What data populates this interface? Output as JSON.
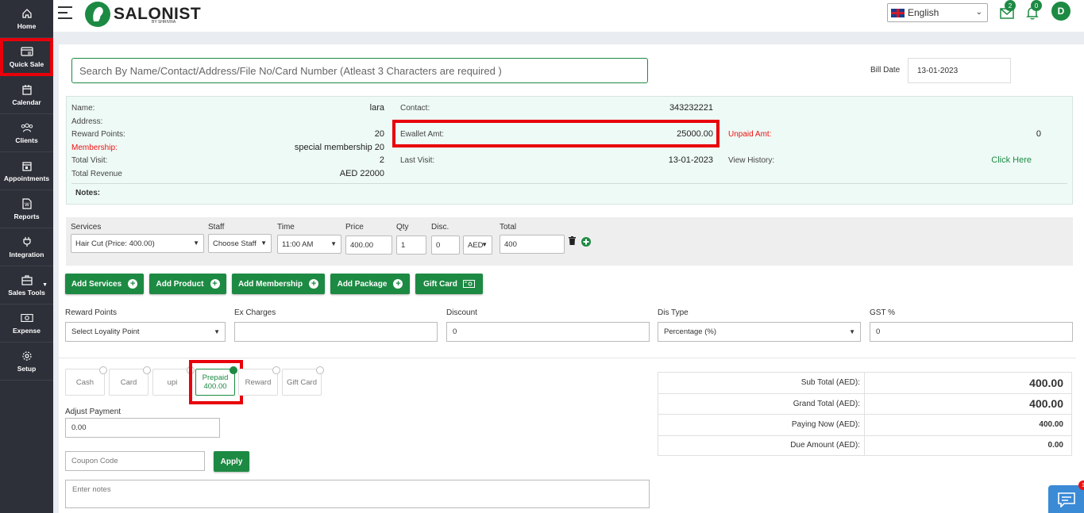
{
  "sidebar": {
    "items": [
      {
        "label": "Home",
        "icon": "home-icon"
      },
      {
        "label": "Quick Sale",
        "icon": "quick-sale-icon"
      },
      {
        "label": "Calendar",
        "icon": "calendar-icon"
      },
      {
        "label": "Clients",
        "icon": "clients-icon"
      },
      {
        "label": "Appointments",
        "icon": "appointments-icon"
      },
      {
        "label": "Reports",
        "icon": "reports-icon"
      },
      {
        "label": "Integration",
        "icon": "plug-icon"
      },
      {
        "label": "Sales Tools",
        "icon": "briefcase-icon"
      },
      {
        "label": "Expense",
        "icon": "money-icon"
      },
      {
        "label": "Setup",
        "icon": "gear-icon"
      }
    ]
  },
  "header": {
    "logo": "SALONIST",
    "logo_sub": "BY SHRIVRA",
    "language": "English",
    "mail_count": "2",
    "notif_count": "0",
    "avatar": "D"
  },
  "search": {
    "placeholder": "Search By Name/Contact/Address/File No/Card Number (Atleast 3 Characters are required )",
    "bill_date_label": "Bill Date",
    "bill_date": "13-01-2023"
  },
  "client": {
    "name_label": "Name:",
    "name": "lara",
    "address_label": "Address:",
    "reward_label": "Reward Points:",
    "reward": "20",
    "membership_label": "Membership:",
    "membership": "special membership 20",
    "visit_label": "Total Visit:",
    "visit": "2",
    "revenue_label": "Total Revenue",
    "revenue": "AED 22000",
    "contact_label": "Contact:",
    "contact": "343232221",
    "ewallet_label": "Ewallet Amt:",
    "ewallet": "25000.00",
    "last_visit_label": "Last Visit:",
    "last_visit": "13-01-2023",
    "unpaid_label": "Unpaid Amt:",
    "unpaid": "0",
    "history_label": "View History:",
    "history_link": "Click Here",
    "notes_label": "Notes:"
  },
  "service_row": {
    "headers": {
      "services": "Services",
      "staff": "Staff",
      "time": "Time",
      "price": "Price",
      "qty": "Qty",
      "disc": "Disc.",
      "total": "Total"
    },
    "service": "Hair Cut (Price: 400.00)",
    "staff": "Choose Staff",
    "time": "11:00 AM",
    "price": "400.00",
    "qty": "1",
    "disc": "0",
    "disc_type": "AED",
    "total": "400"
  },
  "actions": {
    "add_services": "Add Services",
    "add_product": "Add Product",
    "add_membership": "Add Membership",
    "add_package": "Add Package",
    "gift_card": "Gift Card"
  },
  "options": {
    "reward_label": "Reward Points",
    "reward_placeholder": "Select Loyality Point",
    "ex_label": "Ex Charges",
    "ex_value": "",
    "discount_label": "Discount",
    "discount_value": "0",
    "dis_type_label": "Dis Type",
    "dis_type": "Percentage (%)",
    "gst_label": "GST %",
    "gst_value": "0"
  },
  "payment": {
    "methods": [
      "Cash",
      "Card",
      "upi",
      "Prepaid",
      "Reward",
      "Gift Card"
    ],
    "prepaid_amount": "400.00",
    "adjust_label": "Adjust Payment",
    "adjust_value": "0.00",
    "coupon_placeholder": "Coupon Code",
    "apply": "Apply",
    "notes_placeholder": "Enter notes"
  },
  "summary": {
    "sub_total_label": "Sub Total (AED):",
    "sub_total": "400.00",
    "grand_total_label": "Grand Total (AED):",
    "grand_total": "400.00",
    "paying_now_label": "Paying Now (AED):",
    "paying_now": "400.00",
    "due_label": "Due Amount (AED):",
    "due": "0.00"
  },
  "chat_badge": "1",
  "colors": {
    "brand": "#1d8a43",
    "highlight": "#e8000b",
    "sidebar": "#2d3039"
  }
}
